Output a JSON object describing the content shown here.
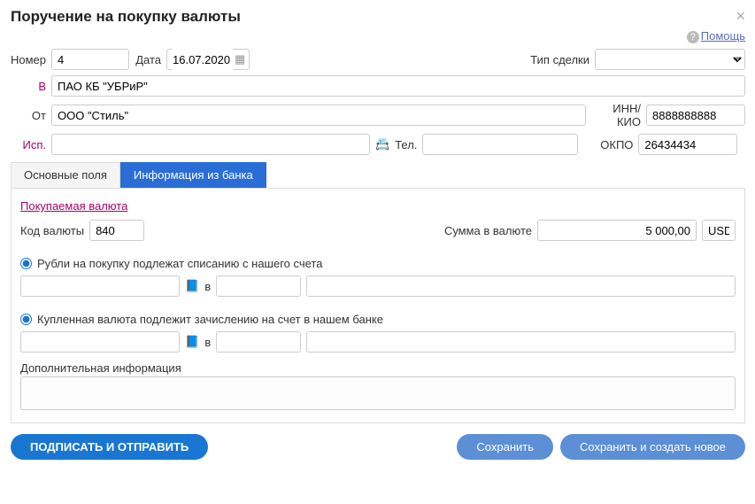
{
  "dialog": {
    "title": "Поручение на покупку валюты"
  },
  "help": {
    "label": "Помощь"
  },
  "fields": {
    "number_label": "Номер",
    "number_value": "4",
    "date_label": "Дата",
    "date_value": "16.07.2020",
    "deal_type_label": "Тип сделки",
    "bank_link": "В",
    "bank_value": "ПАО КБ \"УБРиР\"",
    "from_label": "От",
    "from_value": "ООО \"Стиль\"",
    "inn_label": "ИНН/КИО",
    "inn_value": "8888888888",
    "isp_label": "Исп.",
    "tel_label": "Тел.",
    "okpo_label": "ОКПО",
    "okpo_value": "26434434"
  },
  "tabs": {
    "main": "Основные поля",
    "bank_info": "Информация из банка"
  },
  "purchase": {
    "section": "Покупаемая валюта",
    "code_label": "Код валюты",
    "code_value": "840",
    "amount_label": "Сумма в валюте",
    "amount_value": "5 000,00",
    "code_unit": "USD"
  },
  "rub_section": {
    "radio_label": "Рубли на покупку подлежат списанию с нашего счета",
    "v_label": "в"
  },
  "credit_section": {
    "radio_label": "Купленная валюта подлежит зачислению на счет в нашем банке",
    "v_label": "в"
  },
  "additional": {
    "label": "Дополнительная информация"
  },
  "buttons": {
    "sign_send": "ПОДПИСАТЬ И ОТПРАВИТЬ",
    "save": "Сохранить",
    "save_new": "Сохранить и создать новое"
  }
}
